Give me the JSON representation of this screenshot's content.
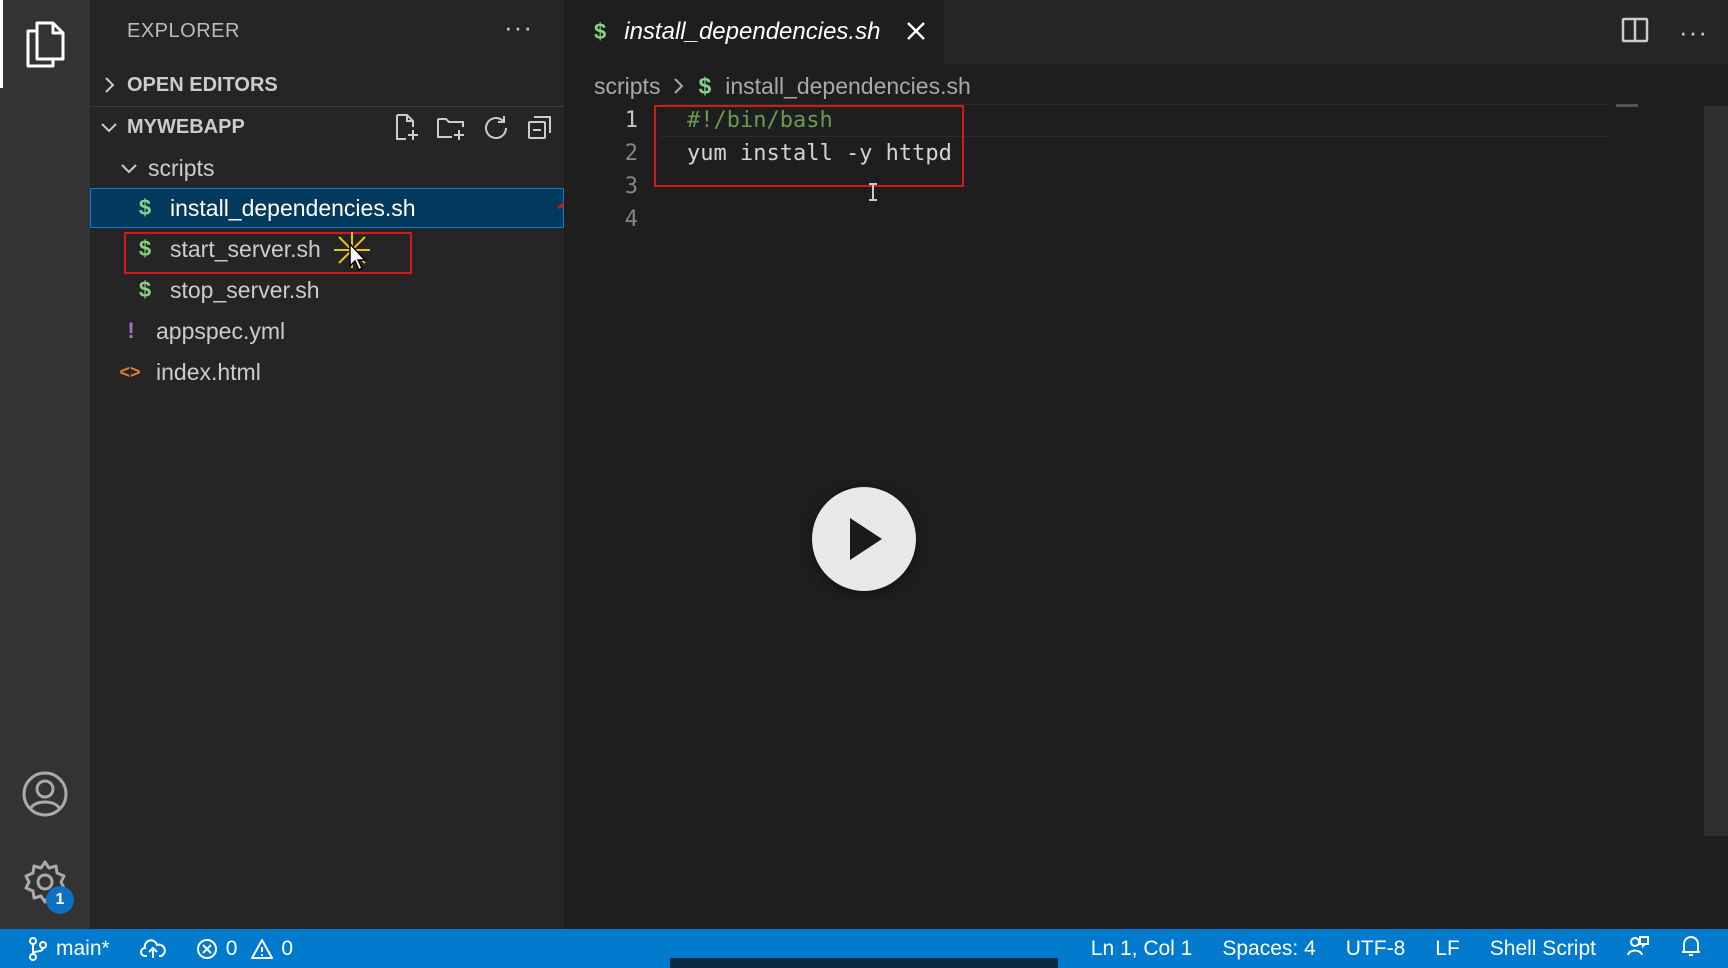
{
  "explorer": {
    "title": "EXPLORER",
    "more": "···",
    "open_editors_label": "OPEN EDITORS",
    "project_label": "MYWEBAPP",
    "tree": [
      {
        "label": "scripts",
        "type": "folder"
      },
      {
        "label": "install_dependencies.sh",
        "type": "shell",
        "icon": "$",
        "selected": true
      },
      {
        "label": "start_server.sh",
        "type": "shell",
        "icon": "$"
      },
      {
        "label": "stop_server.sh",
        "type": "shell",
        "icon": "$"
      },
      {
        "label": "appspec.yml",
        "type": "yaml",
        "icon": "!"
      },
      {
        "label": "index.html",
        "type": "html",
        "icon": "<>"
      }
    ]
  },
  "editor": {
    "tab_icon": "$",
    "tab_title": "install_dependencies.sh",
    "more": "···",
    "breadcrumb": {
      "folder": "scripts",
      "file_icon": "$",
      "file": "install_dependencies.sh"
    },
    "lines": [
      {
        "number": "1",
        "code": "#!/bin/bash",
        "kind": "comment"
      },
      {
        "number": "2",
        "code": "yum install -y httpd",
        "kind": "code"
      },
      {
        "number": "3",
        "code": "",
        "kind": "code"
      },
      {
        "number": "4",
        "code": "",
        "kind": "code"
      }
    ]
  },
  "activity": {
    "settings_badge": "1"
  },
  "statusbar": {
    "branch": "main*",
    "errors": "0",
    "warnings": "0",
    "position": "Ln 1, Col 1",
    "spaces": "Spaces: 4",
    "encoding": "UTF-8",
    "eol": "LF",
    "language": "Shell Script"
  },
  "colors": {
    "accent": "#007acc",
    "selection": "#04395e",
    "annotation_red": "#d11a1a",
    "shell_icon": "#89d185",
    "yaml_icon": "#a074c4",
    "html_icon": "#e37933",
    "comment": "#6a9955"
  },
  "icons": [
    "files-icon",
    "account-icon",
    "gear-icon",
    "chevron-right-icon",
    "chevron-down-icon",
    "new-file-icon",
    "new-folder-icon",
    "refresh-icon",
    "collapse-all-icon",
    "close-icon",
    "split-editor-icon",
    "play-icon",
    "git-branch-icon",
    "cloud-sync-icon",
    "error-icon",
    "warning-icon",
    "feedback-icon",
    "bell-icon"
  ]
}
